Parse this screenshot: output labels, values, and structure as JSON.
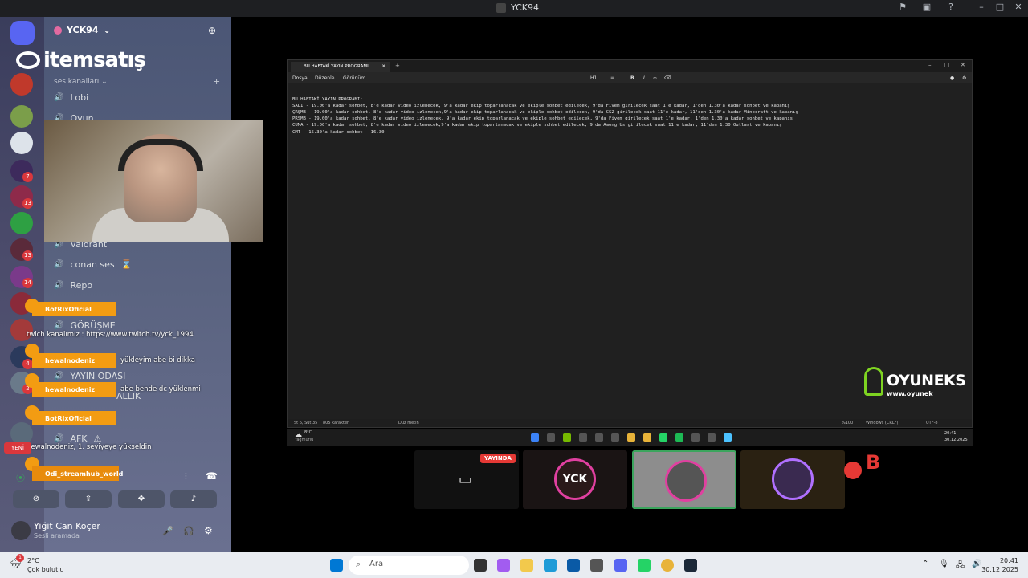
{
  "window": {
    "title": "YCK94"
  },
  "server": {
    "name": "YCK94",
    "category": "ses kanalları"
  },
  "channels": [
    {
      "label": "Lobi"
    },
    {
      "label": "Oyun"
    },
    {
      "label": "Valorant"
    },
    {
      "label": "conan ses"
    },
    {
      "label": "Repo"
    },
    {
      "label": "GÖRÜŞME"
    },
    {
      "label": "YAYIN ODASI"
    },
    {
      "label": "ALLIK"
    },
    {
      "label": "AFK"
    }
  ],
  "server_badges": [
    "7",
    "13",
    "13",
    "14",
    "4",
    "2"
  ],
  "overlay": {
    "brand": "itemsatış"
  },
  "chat": [
    {
      "user": "BotRixOficial",
      "text": "twich kanalımız : https://www.twitch.tv/yck_1994"
    },
    {
      "user": "hewalnodeniz",
      "text": "yükleyim abe bi dikka"
    },
    {
      "user": "hewalnodeniz",
      "text": "abe bende dc yüklenmi"
    },
    {
      "user": "BotRixOficial",
      "text": "hewalnodeniz, 1. seviyeye yükseldin"
    },
    {
      "user": "Odi_streamhub_world",
      "text": ""
    }
  ],
  "new_badge": "YENİ",
  "user": {
    "name": "Yiğit Can Koçer",
    "status": "Sesli aramada"
  },
  "notepad": {
    "tab": "BU HAFTAKİ YAYIN PROGRAMI",
    "menu": [
      "Dosya",
      "Düzenle",
      "Görünüm"
    ],
    "heading_format": "H1",
    "lines": [
      "BU HAFTAKİ YAYIN PROGRAMI:",
      "SALI - 19.00'a kadar sohbet, 8'e kadar video izlenecek, 9'a kadar ekip toparlanacak ve ekiple sohbet edilecek, 9'da Fivem girilecek saat 1'e kadar, 1'den 1.30'a kadar sohbet ve kapanış",
      "ÇRŞMB - 19.00'a kadar sohbet, 8'e kadar video izlenecek,9'a kadar ekip toparlanacak ve ekiple sohbet edilecek, 9'da CS2 girilecek saat 11'e kadar, 11'den 1.30'a kadar Minecraft ve kapanış",
      "PRŞMB - 19.00'a kadar sohbet, 8'e kadar video izlenecek, 9'a kadar ekip toparlanacak ve ekiple sohbet edilecek, 9'da Fivem girilecek saat 1'e kadar, 1'den 1.30'a kadar sohbet ve kapanış",
      "CUMA - 19.00'a kadar sohbet, 8'e kadar video izlenecek,9'a kadar ekip toparlanacak ve ekiple sohbet edilecek, 9'da Among Us girilecek saat 11'e kadar, 11'den 1.30 Outlast ve kapanış",
      "CMT - 15.30'a kadar sohbet - 16.30"
    ],
    "status": {
      "position": "St 6, Süt 35",
      "chars": "805 karakter",
      "format": "Düz metin",
      "zoom": "%100",
      "eol": "Windows (CRLF)",
      "encoding": "UTF-8"
    }
  },
  "oyuneks": {
    "name": "OYUNEKS",
    "url": "www.oyunek"
  },
  "inner_taskbar": {
    "weather": "8°C",
    "weather_desc": "Yağmurlu",
    "time": "20:41",
    "date": "30.12.2025"
  },
  "stream": {
    "live_label": "YAYINDA",
    "tile_text": "YCK"
  },
  "taskbar": {
    "weather_temp": "2°C",
    "weather_desc": "Çok bulutlu",
    "search_placeholder": "Ara",
    "time": "20:41",
    "date": "30.12.2025",
    "notif_badge": "1"
  },
  "colors": {
    "discord_blurple": "#5865f2",
    "chat_orange": "#f39c12",
    "live_red": "#e53935",
    "oyuneks_green": "#7ed321"
  }
}
